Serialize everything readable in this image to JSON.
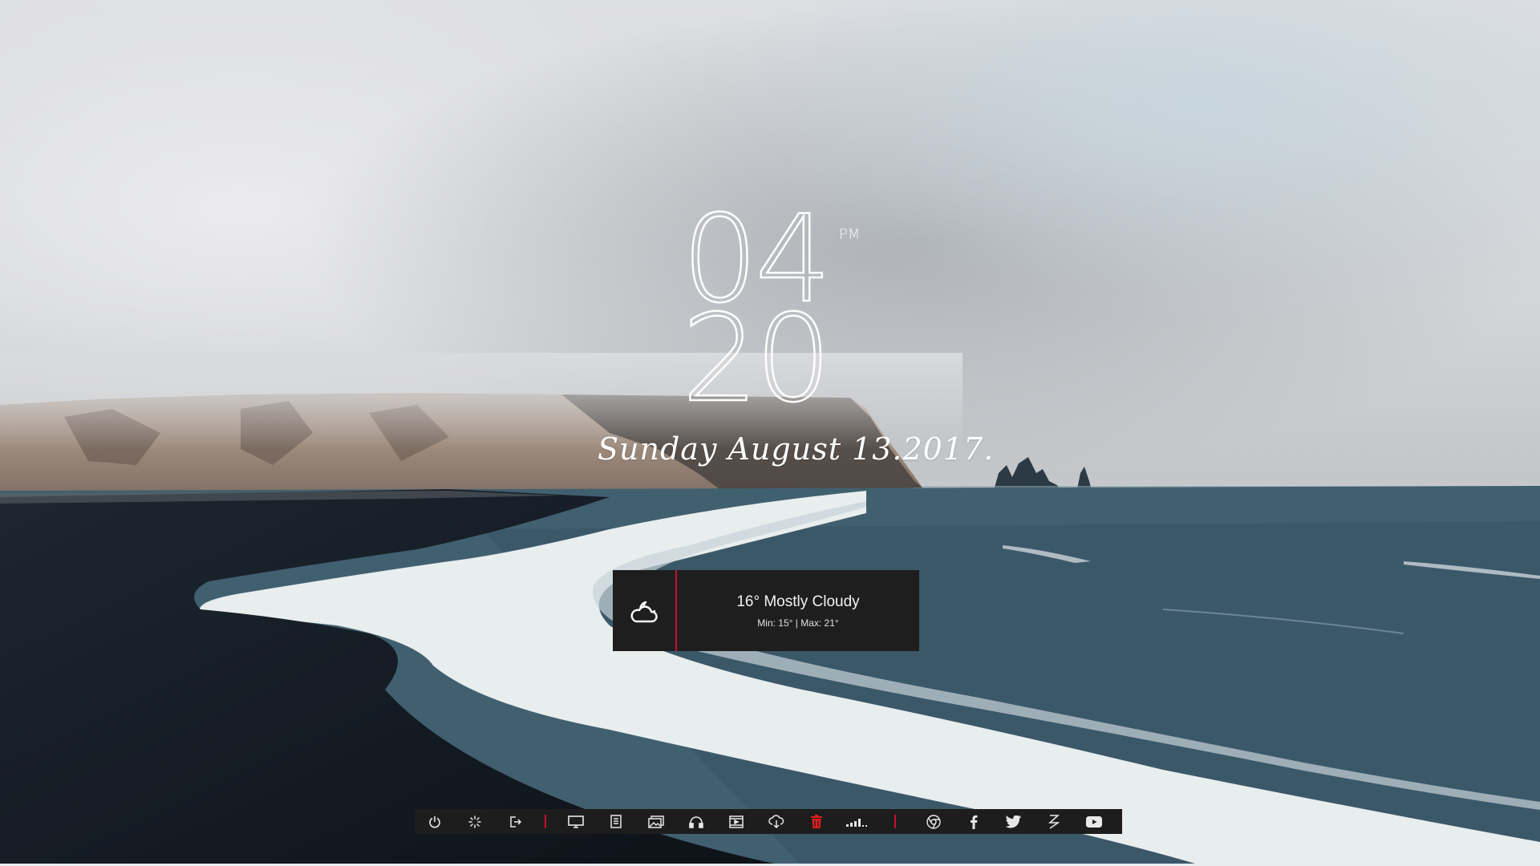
{
  "clock": {
    "hours": "04",
    "minutes": "20",
    "ampm": "PM"
  },
  "date": {
    "text": "Sunday August 13.2017."
  },
  "weather": {
    "icon": "cloudy-night-icon",
    "summary": "16° Mostly Cloudy",
    "minmax": "Min: 15° | Max: 21°"
  },
  "dock": {
    "groups": [
      [
        "power-icon",
        "loading-spinner-icon",
        "logout-icon"
      ],
      [
        "monitor-icon",
        "document-icon",
        "pictures-icon",
        "headphones-icon",
        "video-icon",
        "cloud-download-icon",
        "trash-icon",
        "signal-bars-icon"
      ],
      [
        "chrome-icon",
        "facebook-icon",
        "twitter-icon",
        "deviantart-icon",
        "youtube-icon"
      ]
    ]
  },
  "colors": {
    "accent": "#c8102e",
    "widget_bg": "#1e1e1f",
    "icon": "#e8e8e8",
    "trash": "#e0201c"
  }
}
